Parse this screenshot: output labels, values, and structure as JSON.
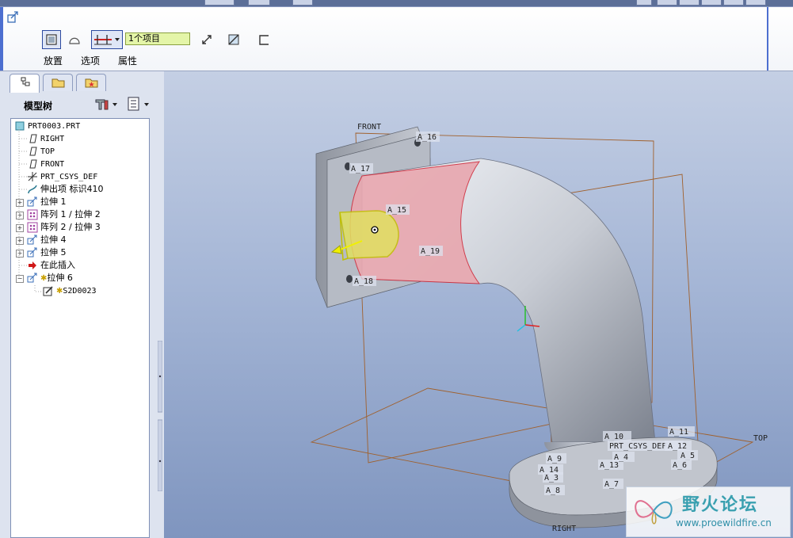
{
  "dashboard": {
    "collector_value": "1个项目",
    "tabs": [
      "放置",
      "选项",
      "属性"
    ]
  },
  "model_tree": {
    "title": "模型树",
    "items": [
      {
        "label": "PRT0003.PRT",
        "icon": "part-icon",
        "expandable": false
      },
      {
        "label": "RIGHT",
        "icon": "datum-plane-icon",
        "expandable": false
      },
      {
        "label": "TOP",
        "icon": "datum-plane-icon",
        "expandable": false
      },
      {
        "label": "FRONT",
        "icon": "datum-plane-icon",
        "expandable": false
      },
      {
        "label": "PRT_CSYS_DEF",
        "icon": "csys-icon",
        "expandable": false
      },
      {
        "label": "伸出项 标识410",
        "icon": "protrusion-icon",
        "expandable": false
      },
      {
        "label": "拉伸 1",
        "icon": "extrude-icon",
        "expandable": true
      },
      {
        "label": "阵列 1 / 拉伸 2",
        "icon": "pattern-icon",
        "expandable": true
      },
      {
        "label": "阵列 2 / 拉伸 3",
        "icon": "pattern-icon",
        "expandable": true
      },
      {
        "label": "拉伸 4",
        "icon": "extrude-icon",
        "expandable": true
      },
      {
        "label": "拉伸 5",
        "icon": "extrude-icon",
        "expandable": true
      },
      {
        "label": "在此插入",
        "icon": "insert-arrow-icon",
        "expandable": false
      },
      {
        "label": "拉伸 6",
        "icon": "extrude-active-icon",
        "expandable": true,
        "expanded": true
      },
      {
        "label": "S2D0023",
        "icon": "sketch-icon",
        "expandable": false
      }
    ]
  },
  "viewport": {
    "datum_labels": {
      "front": "FRONT",
      "top": "TOP",
      "right": "RIGHT",
      "a16": "A_16",
      "a17": "A_17",
      "a15": "A_15",
      "a19": "A_19",
      "a18": "A_18",
      "a10": "A_10",
      "a11": "A_11",
      "a12": "A_12",
      "a13": "A_13",
      "a14": "A_14",
      "a3": "A_3",
      "a4": "A_4",
      "a5": "A_5",
      "a6": "A_6",
      "a7": "A_7",
      "a8": "A_8",
      "a9": "A_9",
      "csys": "PRT_CSYS_DEF"
    }
  },
  "watermark": {
    "title": "野火论坛",
    "url": "www.proewildfire.cn"
  },
  "colors": {
    "accent": "#4d6fd0",
    "selection_yellow": "#f0f000",
    "highlight_pink": "#e8a8b0",
    "datum_orange": "#a0602c"
  }
}
